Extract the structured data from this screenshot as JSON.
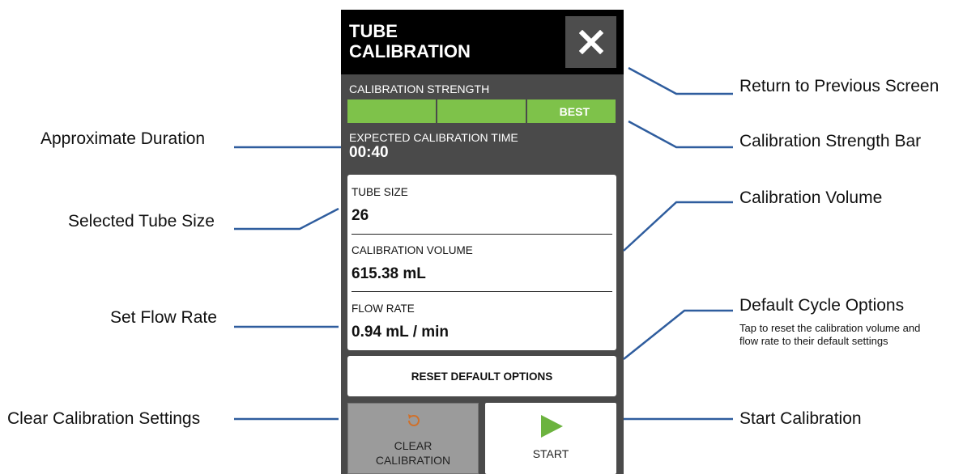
{
  "screen": {
    "title": "TUBE\nCALIBRATION",
    "close_icon": "close-icon",
    "strength": {
      "label": "CALIBRATION STRENGTH",
      "segments": [
        "",
        "",
        "BEST"
      ],
      "level_filled": 3,
      "level_total": 3,
      "color": "#7ec24a"
    },
    "time": {
      "label": "EXPECTED CALIBRATION TIME",
      "value": "00:40"
    },
    "fields": [
      {
        "label": "TUBE SIZE",
        "value": "26"
      },
      {
        "label": "CALIBRATION VOLUME",
        "value": "615.38 mL"
      },
      {
        "label": "FLOW RATE",
        "value": "0.94 mL / min"
      }
    ],
    "reset_button": "RESET DEFAULT OPTIONS",
    "clear_button": {
      "label_line1": "CLEAR",
      "label_line2": "CALIBRATION",
      "icon": "refresh-icon"
    },
    "start_button": {
      "label": "START",
      "icon": "play-icon",
      "color": "#6cb33f"
    }
  },
  "callouts": {
    "approx_duration": "Approximate Duration",
    "selected_tube_size": "Selected Tube Size",
    "set_flow_rate": "Set Flow Rate",
    "clear_settings": "Clear Calibration Settings",
    "return_previous": "Return to Previous Screen",
    "strength_bar": "Calibration Strength Bar",
    "calibration_volume": "Calibration Volume",
    "default_cycle": "Default Cycle Options",
    "default_cycle_desc": "Tap to reset the calibration volume and flow rate to their default settings",
    "start_calibration": "Start Calibration"
  },
  "colors": {
    "leader_line": "#2f5d9e",
    "header": "#000000",
    "panel": "#4a4a4a"
  }
}
